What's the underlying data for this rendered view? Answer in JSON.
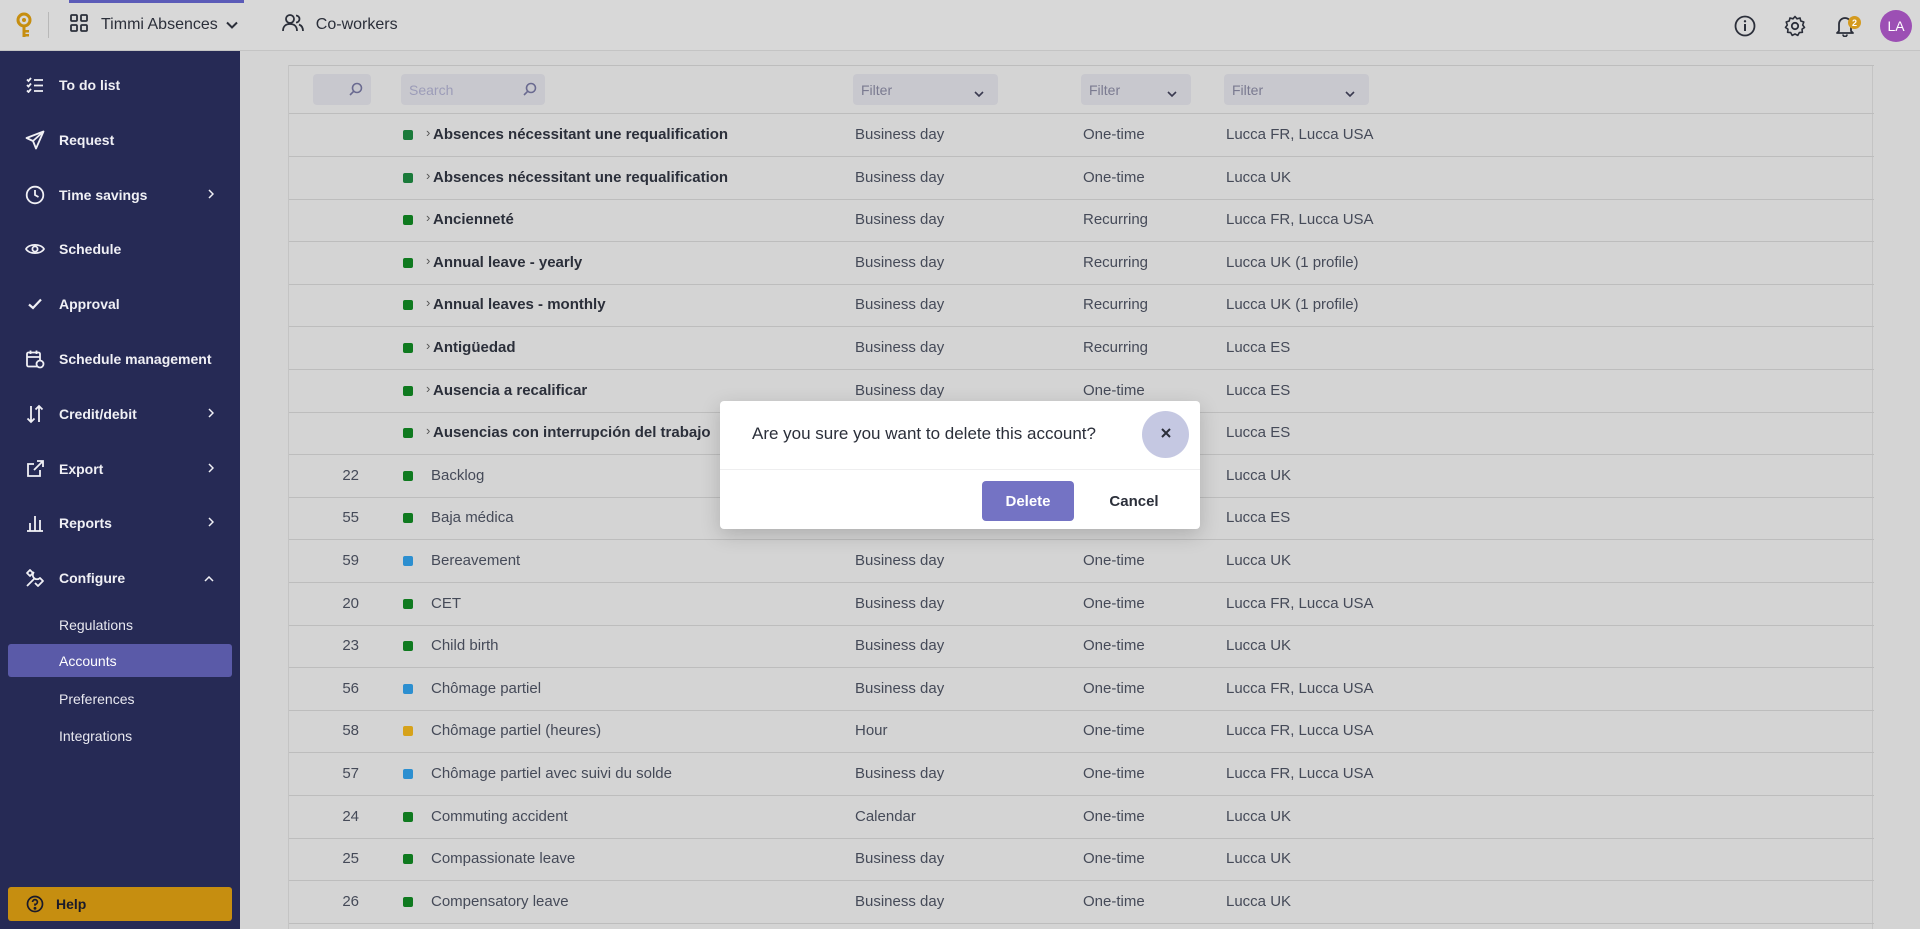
{
  "topbar": {
    "app_name": "Timmi Absences",
    "coworkers_label": "Co-workers",
    "notification_count": "2",
    "avatar_initials": "LA"
  },
  "sidebar": {
    "items": [
      {
        "label": "To do list",
        "icon": "checklist-icon",
        "has_arrow": false
      },
      {
        "label": "Request",
        "icon": "paper-plane-icon",
        "has_arrow": false
      },
      {
        "label": "Time savings",
        "icon": "clock-icon",
        "has_arrow": true
      },
      {
        "label": "Schedule",
        "icon": "eye-icon",
        "has_arrow": false
      },
      {
        "label": "Approval",
        "icon": "check-icon",
        "has_arrow": false
      },
      {
        "label": "Schedule management",
        "icon": "calendar-icon",
        "has_arrow": false
      },
      {
        "label": "Credit/debit",
        "icon": "up-down-arrows-icon",
        "has_arrow": true
      },
      {
        "label": "Export",
        "icon": "external-link-icon",
        "has_arrow": true
      },
      {
        "label": "Reports",
        "icon": "bar-chart-icon",
        "has_arrow": true
      },
      {
        "label": "Configure",
        "icon": "tools-icon",
        "has_arrow": true
      }
    ],
    "configure_sub": [
      "Regulations",
      "Accounts",
      "Preferences",
      "Integrations"
    ],
    "active_sub": "Accounts",
    "help_label": "Help"
  },
  "filters": {
    "search_placeholder": "Search",
    "filter_placeholder": "Filter"
  },
  "table": {
    "rows": [
      {
        "id": "",
        "name": "Absences nécessitant une requalification",
        "group": true,
        "color": "#1a7a3a",
        "unit": "Business day",
        "type": "One-time",
        "scope": "Lucca FR, Lucca USA"
      },
      {
        "id": "",
        "name": "Absences nécessitant une requalification",
        "group": true,
        "color": "#1a7a3a",
        "unit": "Business day",
        "type": "One-time",
        "scope": "Lucca UK"
      },
      {
        "id": "",
        "name": "Ancienneté",
        "group": true,
        "color": "#0f7a1f",
        "unit": "Business day",
        "type": "Recurring",
        "scope": "Lucca FR, Lucca USA"
      },
      {
        "id": "",
        "name": "Annual leave - yearly",
        "group": true,
        "color": "#0f7a1f",
        "unit": "Business day",
        "type": "Recurring",
        "scope": "Lucca UK (1 profile)"
      },
      {
        "id": "",
        "name": "Annual leaves - monthly",
        "group": true,
        "color": "#0f7a1f",
        "unit": "Business day",
        "type": "Recurring",
        "scope": "Lucca UK (1 profile)"
      },
      {
        "id": "",
        "name": "Antigüedad",
        "group": true,
        "color": "#0f7a1f",
        "unit": "Business day",
        "type": "Recurring",
        "scope": "Lucca ES"
      },
      {
        "id": "",
        "name": "Ausencia a recalificar",
        "group": true,
        "color": "#0f7a1f",
        "unit": "Business day",
        "type": "One-time",
        "scope": "Lucca ES"
      },
      {
        "id": "",
        "name": "Ausencias con interrupción del trabajo",
        "group": true,
        "color": "#0f7a1f",
        "unit": "",
        "type": "",
        "scope": "Lucca ES"
      },
      {
        "id": "22",
        "name": "Backlog",
        "group": false,
        "color": "#0f7a1f",
        "unit": "",
        "type": "",
        "scope": "Lucca UK"
      },
      {
        "id": "55",
        "name": "Baja médica",
        "group": false,
        "color": "#0f7a1f",
        "unit": "",
        "type": "",
        "scope": "Lucca ES"
      },
      {
        "id": "59",
        "name": "Bereavement",
        "group": false,
        "color": "#2c8fd0",
        "unit": "Business day",
        "type": "One-time",
        "scope": "Lucca UK"
      },
      {
        "id": "20",
        "name": "CET",
        "group": false,
        "color": "#0f7a1f",
        "unit": "Business day",
        "type": "One-time",
        "scope": "Lucca FR, Lucca USA"
      },
      {
        "id": "23",
        "name": "Child birth",
        "group": false,
        "color": "#0f7a1f",
        "unit": "Business day",
        "type": "One-time",
        "scope": "Lucca UK"
      },
      {
        "id": "56",
        "name": "Chômage partiel",
        "group": false,
        "color": "#2c8fd0",
        "unit": "Business day",
        "type": "One-time",
        "scope": "Lucca FR, Lucca USA"
      },
      {
        "id": "58",
        "name": "Chômage partiel (heures)",
        "group": false,
        "color": "#d6a21a",
        "unit": "Hour",
        "type": "One-time",
        "scope": "Lucca FR, Lucca USA"
      },
      {
        "id": "57",
        "name": "Chômage partiel avec suivi du solde",
        "group": false,
        "color": "#2c8fd0",
        "unit": "Business day",
        "type": "One-time",
        "scope": "Lucca FR, Lucca USA"
      },
      {
        "id": "24",
        "name": "Commuting accident",
        "group": false,
        "color": "#0f7a1f",
        "unit": "Calendar",
        "type": "One-time",
        "scope": "Lucca UK"
      },
      {
        "id": "25",
        "name": "Compassionate leave",
        "group": false,
        "color": "#0f7a1f",
        "unit": "Business day",
        "type": "One-time",
        "scope": "Lucca UK"
      },
      {
        "id": "26",
        "name": "Compensatory leave",
        "group": false,
        "color": "#0f7a1f",
        "unit": "Business day",
        "type": "One-time",
        "scope": "Lucca UK"
      }
    ]
  },
  "modal": {
    "title": "Are you sure you want to delete this account?",
    "delete_label": "Delete",
    "cancel_label": "Cancel"
  },
  "colors": {
    "sidebar_bg": "#262a55",
    "accent": "#7473c4",
    "help_bg": "#c68e10"
  }
}
